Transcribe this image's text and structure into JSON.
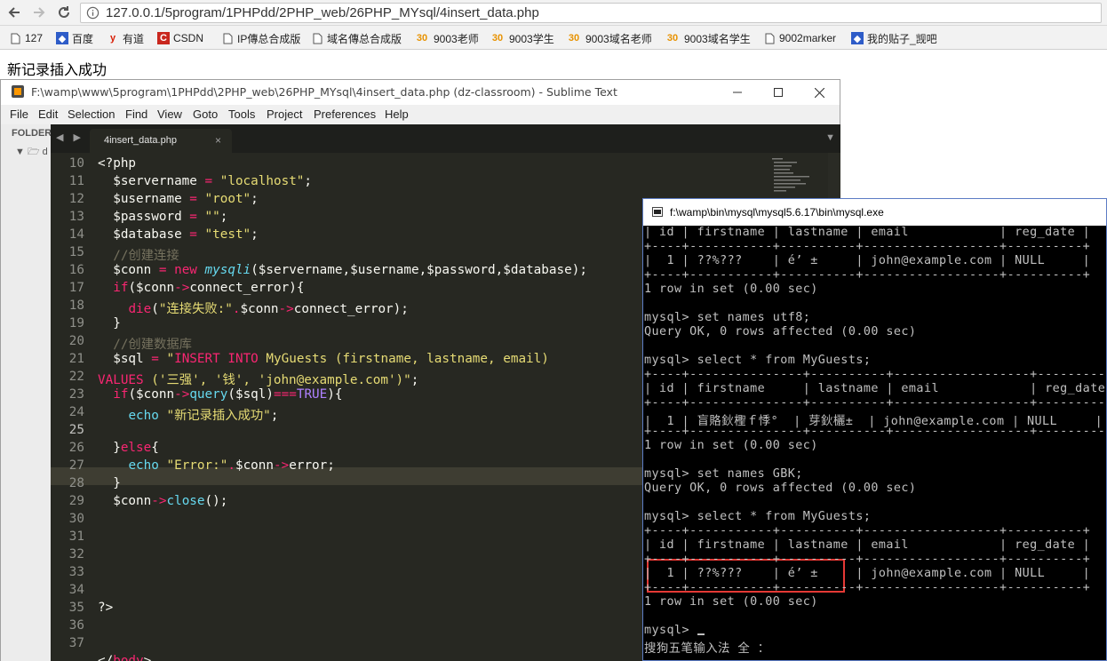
{
  "browser": {
    "url": "127.0.0.1/5program/1PHPdd/2PHP_web/26PHP_MYsql/4insert_data.php",
    "bookmarks": [
      {
        "icon": "page-icon",
        "label": "127"
      },
      {
        "icon": "paw-icon",
        "label": "百度"
      },
      {
        "icon": "youdao-icon",
        "label": "有道"
      },
      {
        "icon": "csdn-icon",
        "label": "CSDN"
      },
      {
        "icon": "page-icon",
        "label": "IP傳总合成版"
      },
      {
        "icon": "page-icon",
        "label": "域名傳总合成版"
      },
      {
        "icon": "folder30-icon",
        "label": "9003老师"
      },
      {
        "icon": "folder30-icon",
        "label": "9003学生"
      },
      {
        "icon": "folder30-icon",
        "label": "9003域名老师"
      },
      {
        "icon": "folder30-icon",
        "label": "9003域名学生"
      },
      {
        "icon": "page-icon",
        "label": "9002marker"
      },
      {
        "icon": "paw-icon",
        "label": "我的贴子_觊吧"
      }
    ],
    "accent": "#e89200"
  },
  "page": {
    "message": "新记录插入成功"
  },
  "sublime": {
    "title": "F:\\wamp\\www\\5program\\1PHPdd\\2PHP_web\\26PHP_MYsql\\4insert_data.php (dz-classroom) - Sublime Text",
    "menu": [
      "File",
      "Edit",
      "Selection",
      "Find",
      "View",
      "Goto",
      "Tools",
      "Project",
      "Preferences",
      "Help"
    ],
    "sidebar_label": "FOLDER",
    "tree_marker": "▼ 🗁 d",
    "tab": "4insert_data.php",
    "tab_close": "×",
    "line_numbers": [
      "10",
      "11",
      "12",
      "13",
      "14",
      "15",
      "16",
      "17",
      "18",
      "19",
      "20",
      "21",
      "22",
      "23",
      "24",
      "25",
      "26",
      "27",
      "28",
      "29",
      "30",
      "31",
      "32",
      "33",
      "34",
      "35",
      "36",
      "37"
    ],
    "current_line": "25"
  },
  "cmd": {
    "title": "f:\\wamp\\bin\\mysql\\mysql5.6.17\\bin\\mysql.exe",
    "lines": [
      "| id | firstname | lastname | email            | reg_date |",
      "+----+-----------+----------+------------------+----------+",
      "|  1 | ??%???    | é’ ±     | john@example.com | NULL     |",
      "+----+-----------+----------+------------------+----------+",
      "1 row in set (0.00 sec)",
      "",
      "mysql> set names utf8;",
      "Query OK, 0 rows affected (0.00 sec)",
      "",
      "mysql> select * from MyGuests;",
      "+----+---------------+----------+------------------+----------+",
      "| id | firstname     | lastname | email            | reg_date |",
      "+----+---------------+----------+------------------+----------+",
      "|  1 | 盲賂鈥檉ｆ悸°  | 芽鈥欐±  | john@example.com | NULL     |",
      "+----+---------------+----------+------------------+----------+",
      "1 row in set (0.00 sec)",
      "",
      "mysql> set names GBK;",
      "Query OK, 0 rows affected (0.00 sec)",
      "",
      "mysql> select * from MyGuests;",
      "+----+-----------+----------+------------------+----------+",
      "| id | firstname | lastname | email            | reg_date |",
      "+----+-----------+----------+------------------+----------+",
      "|  1 | ??%???    | é’ ±     | john@example.com | NULL     |",
      "+----+-----------+----------+------------------+----------+",
      "1 row in set (0.00 sec)",
      "",
      "mysql> ",
      "搜狗五笔输入法 全 ："
    ]
  }
}
